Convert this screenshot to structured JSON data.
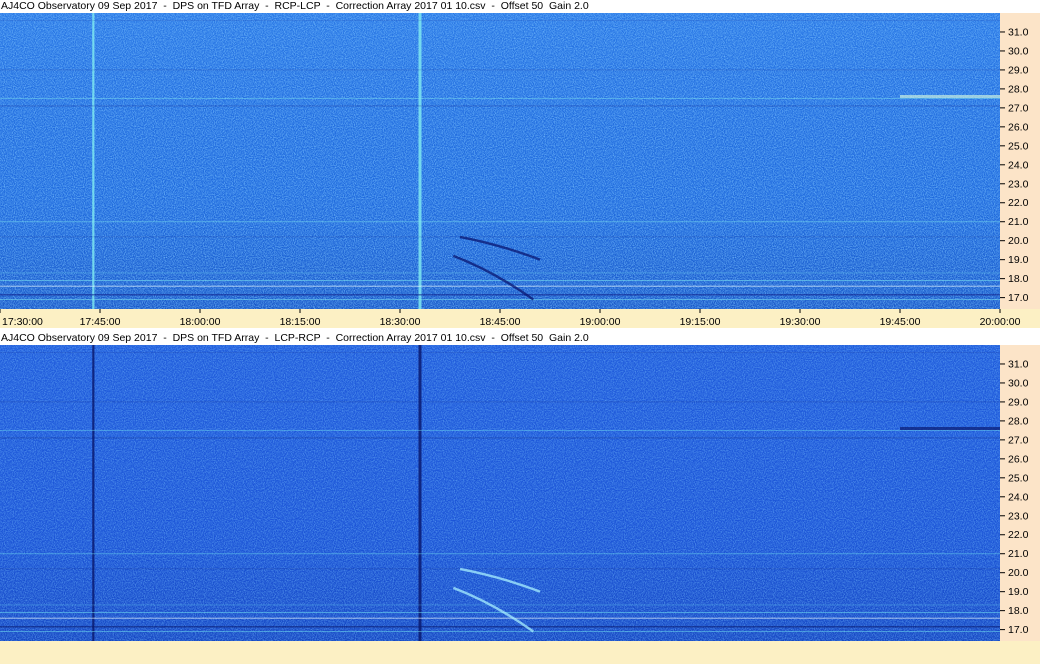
{
  "chart_data": [
    {
      "type": "heatmap",
      "title": "AJ4CO Observatory 09 Sep 2017  -  DPS on TFD Array  -  RCP-LCP  -  Correction Array 2017 01 10.csv  -  Offset 50  Gain 2.0",
      "x_ticks": [
        "17:30:00",
        "17:45:00",
        "18:00:00",
        "18:15:00",
        "18:30:00",
        "18:45:00",
        "19:00:00",
        "19:15:00",
        "19:30:00",
        "19:45:00",
        "20:00:00"
      ],
      "xlim": [
        "17:30:00",
        "20:00:00"
      ],
      "y_ticks": [
        "17.0",
        "18.0",
        "19.0",
        "20.0",
        "21.0",
        "22.0",
        "23.0",
        "24.0",
        "25.0",
        "26.0",
        "27.0",
        "28.0",
        "29.0",
        "30.0",
        "31.0"
      ],
      "ylim": [
        16.4,
        32.0
      ],
      "colors": {
        "base": "#1e6ce0",
        "high": "#7ee8f0",
        "low": "#10208a"
      }
    },
    {
      "type": "heatmap",
      "title": "AJ4CO Observatory 09 Sep 2017  -  DPS on TFD Array  -  LCP-RCP  -  Correction Array 2017 01 10.csv  -  Offset 50  Gain 2.0",
      "x_ticks": [
        "17:30:00",
        "17:45:00",
        "18:00:00",
        "18:15:00",
        "18:30:00",
        "18:45:00",
        "19:00:00",
        "19:15:00",
        "19:30:00",
        "19:45:00",
        "20:00:00"
      ],
      "xlim": [
        "17:30:00",
        "20:00:00"
      ],
      "y_ticks": [
        "17.0",
        "18.0",
        "19.0",
        "20.0",
        "21.0",
        "22.0",
        "23.0",
        "24.0",
        "25.0",
        "26.0",
        "27.0",
        "28.0",
        "29.0",
        "30.0",
        "31.0"
      ],
      "ylim": [
        16.4,
        32.0
      ],
      "colors": {
        "base": "#1a52d8",
        "high": "#6fe0f0",
        "low": "#0a1a70"
      }
    }
  ]
}
